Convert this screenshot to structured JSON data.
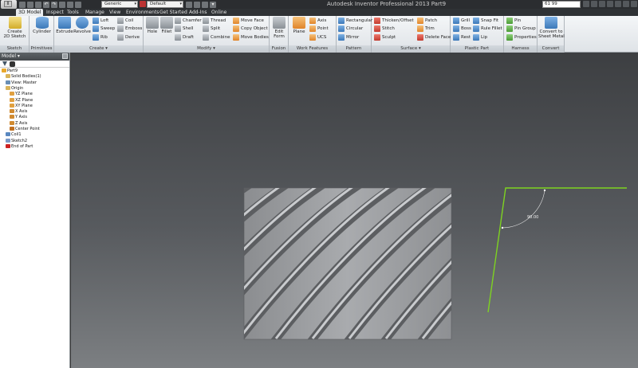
{
  "app": {
    "title": "Autodesk Inventor Professional 2013    Part9",
    "material_value": "Generic",
    "appearance_value": "Default",
    "search_value": "61   99"
  },
  "menu": {
    "tabs": [
      "3D Model",
      "Inspect",
      "Tools",
      "Manage",
      "View",
      "Environments",
      "Get Started",
      "Add-Ins",
      "Online"
    ],
    "active": "3D Model"
  },
  "ribbon": {
    "panels": {
      "sketch": "Sketch",
      "primitives": "Primitives",
      "create": "Create ▾",
      "modify": "Modify ▾",
      "fusion": "Fusion",
      "work_features": "Work Features",
      "pattern": "Pattern",
      "surface": "Surface ▾",
      "plastic_part": "Plastic Part",
      "harness": "Harness",
      "convert": "Convert"
    },
    "buttons": {
      "create_2d_sketch": "Create\n2D Sketch",
      "cylinder": "Cylinder",
      "extrude": "Extrude",
      "revolve": "Revolve",
      "loft": "Loft",
      "sweep": "Sweep",
      "rib": "Rib",
      "coil": "Coil",
      "emboss": "Emboss",
      "derive": "Derive",
      "hole": "Hole",
      "fillet": "Fillet",
      "chamfer": "Chamfer",
      "shell": "Shell",
      "draft": "Draft",
      "thread": "Thread",
      "split": "Split",
      "combine": "Combine",
      "move_face": "Move Face",
      "copy_object": "Copy Object",
      "move_bodies": "Move Bodies",
      "edit_form": "Edit\nForm",
      "plane": "Plane",
      "axis": "Axis",
      "point": "Point",
      "ucs": "UCS",
      "rectangular": "Rectangular",
      "circular": "Circular",
      "mirror": "Mirror",
      "thicken_offset": "Thicken/Offset",
      "stitch": "Stitch",
      "sculpt": "Sculpt",
      "patch": "Patch",
      "trim": "Trim",
      "delete_face": "Delete Face",
      "grill": "Grill",
      "boss": "Boss",
      "rest": "Rest",
      "snap_fit": "Snap Fit",
      "rule_fillet": "Rule Fillet",
      "lip": "Lip",
      "pin": "Pin",
      "pin_group": "Pin Group",
      "properties": "Properties",
      "convert_to_sheet_metal": "Convert to\nSheet Metal"
    }
  },
  "browser": {
    "title": "Model ▾",
    "nodes": [
      {
        "label": "Part9",
        "level": 0,
        "icon": "part-icon"
      },
      {
        "label": "Solid Bodies(1)",
        "level": 1,
        "icon": "folder-icon"
      },
      {
        "label": "View: Master",
        "level": 1,
        "icon": "view-icon"
      },
      {
        "label": "Origin",
        "level": 1,
        "icon": "folder-icon"
      },
      {
        "label": "YZ Plane",
        "level": 2,
        "icon": "plane-icon"
      },
      {
        "label": "XZ Plane",
        "level": 2,
        "icon": "plane-icon"
      },
      {
        "label": "XY Plane",
        "level": 2,
        "icon": "plane-icon"
      },
      {
        "label": "X Axis",
        "level": 2,
        "icon": "axis-icon"
      },
      {
        "label": "Y Axis",
        "level": 2,
        "icon": "axis-icon"
      },
      {
        "label": "Z Axis",
        "level": 2,
        "icon": "axis-icon"
      },
      {
        "label": "Center Point",
        "level": 2,
        "icon": "point-icon"
      },
      {
        "label": "Coil1",
        "level": 1,
        "icon": "coil-icon"
      },
      {
        "label": "Sketch2",
        "level": 1,
        "icon": "sketch-icon"
      },
      {
        "label": "End of Part",
        "level": 1,
        "icon": "end-of-part-icon"
      }
    ]
  },
  "viewport": {
    "dimension_label": "90.00",
    "sketch_color": "#7ed321",
    "part_color": "#9a9c9f"
  }
}
